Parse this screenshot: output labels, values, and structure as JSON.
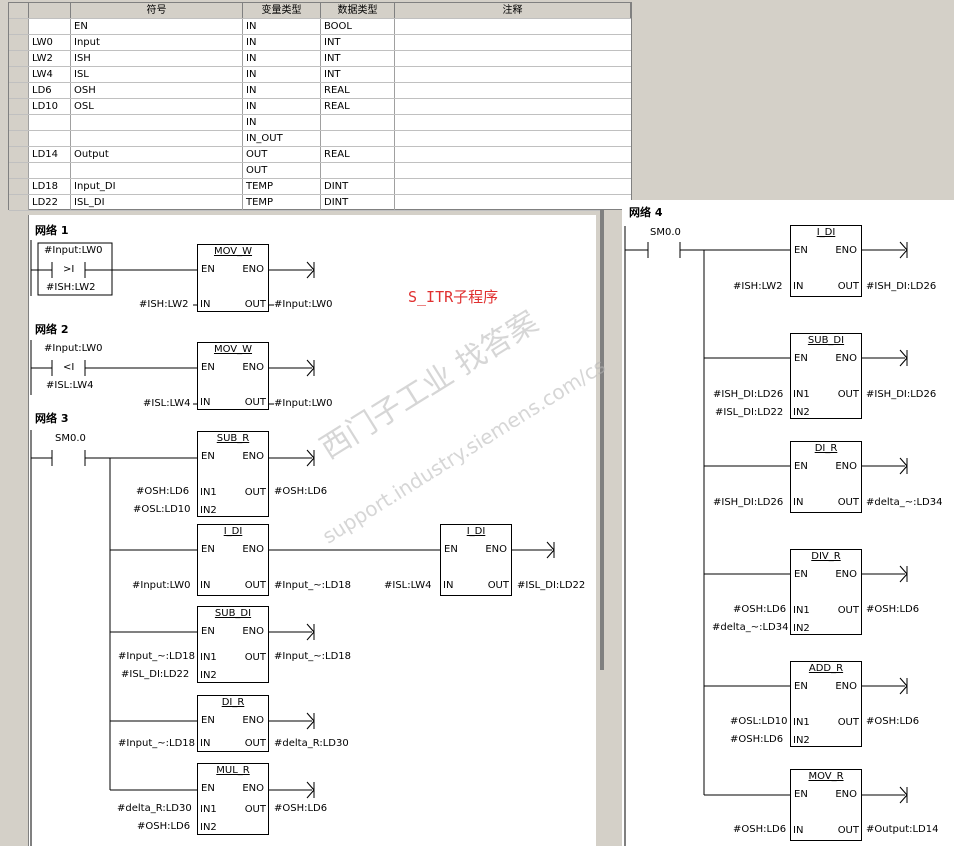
{
  "var_table": {
    "headers": [
      "符号",
      "变量类型",
      "数据类型",
      "注释"
    ],
    "rows": [
      {
        "addr": "",
        "symbol": "EN",
        "var_type": "IN",
        "data_type": "BOOL",
        "comment": ""
      },
      {
        "addr": "LW0",
        "symbol": "Input",
        "var_type": "IN",
        "data_type": "INT",
        "comment": ""
      },
      {
        "addr": "LW2",
        "symbol": "ISH",
        "var_type": "IN",
        "data_type": "INT",
        "comment": ""
      },
      {
        "addr": "LW4",
        "symbol": "ISL",
        "var_type": "IN",
        "data_type": "INT",
        "comment": ""
      },
      {
        "addr": "LD6",
        "symbol": "OSH",
        "var_type": "IN",
        "data_type": "REAL",
        "comment": ""
      },
      {
        "addr": "LD10",
        "symbol": "OSL",
        "var_type": "IN",
        "data_type": "REAL",
        "comment": ""
      },
      {
        "addr": "",
        "symbol": "",
        "var_type": "IN",
        "data_type": "",
        "comment": ""
      },
      {
        "addr": "",
        "symbol": "",
        "var_type": "IN_OUT",
        "data_type": "",
        "comment": ""
      },
      {
        "addr": "LD14",
        "symbol": "Output",
        "var_type": "OUT",
        "data_type": "REAL",
        "comment": ""
      },
      {
        "addr": "",
        "symbol": "",
        "var_type": "OUT",
        "data_type": "",
        "comment": ""
      },
      {
        "addr": "LD18",
        "symbol": "Input_DI",
        "var_type": "TEMP",
        "data_type": "DINT",
        "comment": ""
      },
      {
        "addr": "LD22",
        "symbol": "ISL_DI",
        "var_type": "TEMP",
        "data_type": "DINT",
        "comment": ""
      }
    ]
  },
  "watermark": {
    "title": "S_ITR子程序",
    "line1": "西门子工业   找答案",
    "line2": "support.industry.siemens.com/cs"
  },
  "net1": {
    "title": "网络 1",
    "contact_top": "#Input:LW0",
    "contact_sym": ">I",
    "contact_bot": "#ISH:LW2",
    "block": {
      "name": "MOV_W",
      "en": "EN",
      "eno": "ENO",
      "in": "IN",
      "out": "OUT",
      "in_val": "#ISH:LW2",
      "out_val": "#Input:LW0"
    }
  },
  "net2": {
    "title": "网络 2",
    "contact_top": "#Input:LW0",
    "contact_sym": "<I",
    "contact_bot": "#ISL:LW4",
    "block": {
      "name": "MOV_W",
      "en": "EN",
      "eno": "ENO",
      "in": "IN",
      "out": "OUT",
      "in_val": "#ISL:LW4",
      "out_val": "#Input:LW0"
    }
  },
  "net3": {
    "title": "网络 3",
    "contact": "SM0.0",
    "sub_r": {
      "name": "SUB_R",
      "en": "EN",
      "eno": "ENO",
      "in1": "IN1",
      "in2": "IN2",
      "out": "OUT",
      "in1_val": "#OSH:LD6",
      "in2_val": "#OSL:LD10",
      "out_val": "#OSH:LD6"
    },
    "i_di1": {
      "name": "I_DI",
      "en": "EN",
      "eno": "ENO",
      "in": "IN",
      "out": "OUT",
      "in_val": "#Input:LW0",
      "out_val": "#Input_~:LD18"
    },
    "i_di2": {
      "name": "I_DI",
      "en": "EN",
      "eno": "ENO",
      "in": "IN",
      "out": "OUT",
      "in_val": "#ISL:LW4",
      "out_val": "#ISL_DI:LD22"
    },
    "sub_di": {
      "name": "SUB_DI",
      "en": "EN",
      "eno": "ENO",
      "in1": "IN1",
      "in2": "IN2",
      "out": "OUT",
      "in1_val": "#Input_~:LD18",
      "in2_val": "#ISL_DI:LD22",
      "out_val": "#Input_~:LD18"
    },
    "di_r": {
      "name": "DI_R",
      "en": "EN",
      "eno": "ENO",
      "in": "IN",
      "out": "OUT",
      "in_val": "#Input_~:LD18",
      "out_val": "#delta_R:LD30"
    },
    "mul_r": {
      "name": "MUL_R",
      "en": "EN",
      "eno": "ENO",
      "in1": "IN1",
      "in2": "IN2",
      "out": "OUT",
      "in1_val": "#delta_R:LD30",
      "in2_val": "#OSH:LD6",
      "out_val": "#OSH:LD6"
    }
  },
  "net4": {
    "title": "网络 4",
    "contact": "SM0.0",
    "i_di": {
      "name": "I_DI",
      "en": "EN",
      "eno": "ENO",
      "in": "IN",
      "out": "OUT",
      "in_val": "#ISH:LW2",
      "out_val": "#ISH_DI:LD26"
    },
    "sub_di": {
      "name": "SUB_DI",
      "en": "EN",
      "eno": "ENO",
      "in1": "IN1",
      "in2": "IN2",
      "out": "OUT",
      "in1_val": "#ISH_DI:LD26",
      "in2_val": "#ISL_DI:LD22",
      "out_val": "#ISH_DI:LD26"
    },
    "di_r": {
      "name": "DI_R",
      "en": "EN",
      "eno": "ENO",
      "in": "IN",
      "out": "OUT",
      "in_val": "#ISH_DI:LD26",
      "out_val": "#delta_~:LD34"
    },
    "div_r": {
      "name": "DIV_R",
      "en": "EN",
      "eno": "ENO",
      "in1": "IN1",
      "in2": "IN2",
      "out": "OUT",
      "in1_val": "#OSH:LD6",
      "in2_val": "#delta_~:LD34",
      "out_val": "#OSH:LD6"
    },
    "add_r": {
      "name": "ADD_R",
      "en": "EN",
      "eno": "ENO",
      "in1": "IN1",
      "in2": "IN2",
      "out": "OUT",
      "in1_val": "#OSL:LD10",
      "in2_val": "#OSH:LD6",
      "out_val": "#OSH:LD6"
    },
    "mov_r": {
      "name": "MOV_R",
      "en": "EN",
      "eno": "ENO",
      "in": "IN",
      "out": "OUT",
      "in_val": "#OSH:LD6",
      "out_val": "#Output:LD14"
    }
  }
}
